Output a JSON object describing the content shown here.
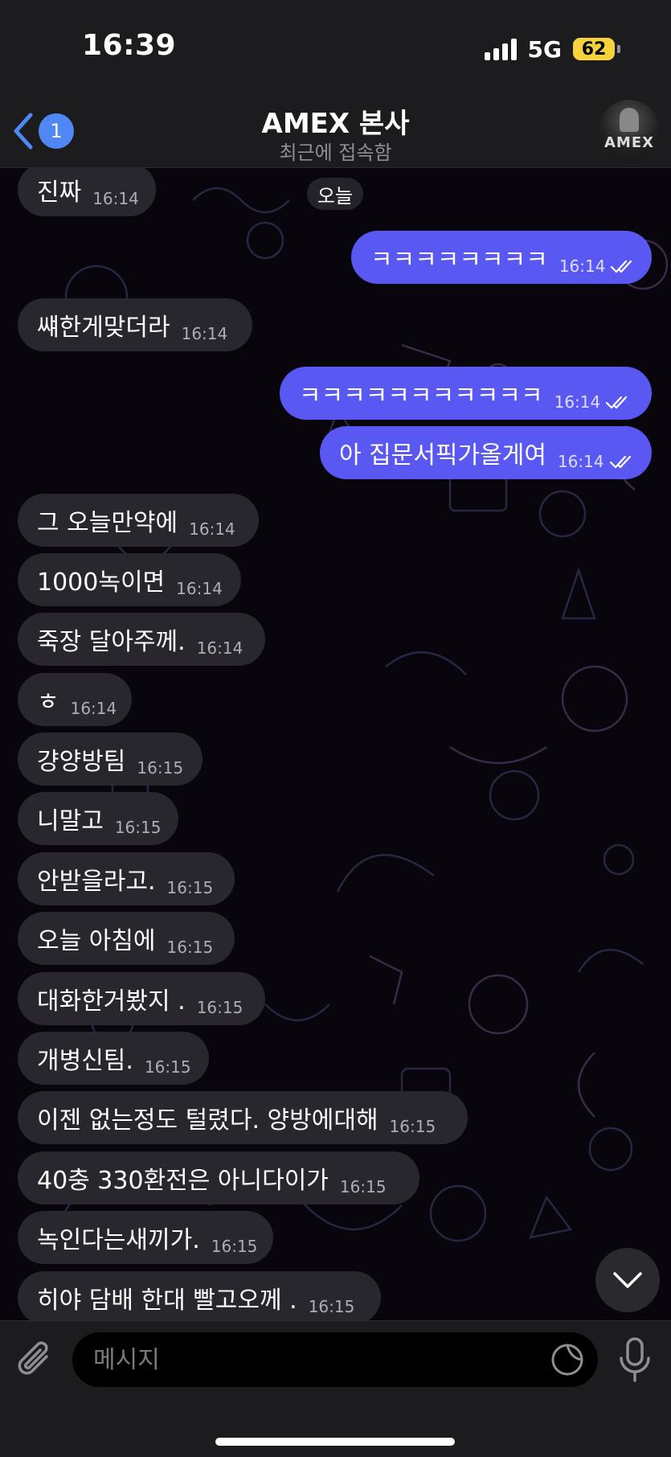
{
  "status_bar": {
    "time": "16:39",
    "network": "5G",
    "battery": "62"
  },
  "header": {
    "back_badge": "1",
    "title": "AMEX 본사",
    "subtitle": "최근에 접속함",
    "avatar_text": "AMEX"
  },
  "chat": {
    "date_label": "오늘",
    "messages": [
      {
        "direction": "in",
        "text": "진짜",
        "time": "16:14"
      },
      {
        "direction": "out",
        "text": "ㅋㅋㅋㅋㅋㅋㅋㅋ",
        "time": "16:14",
        "read": true
      },
      {
        "direction": "in",
        "text": "썌한게맞더라",
        "time": "16:14"
      },
      {
        "direction": "out",
        "text": "ㅋㅋㅋㅋㅋㅋㅋㅋㅋㅋㅋ",
        "time": "16:14",
        "read": true
      },
      {
        "direction": "out",
        "text": "아 집문서픽가올게여",
        "time": "16:14",
        "read": true
      },
      {
        "direction": "in",
        "text": "그 오늘만약에",
        "time": "16:14"
      },
      {
        "direction": "in",
        "text": "1000녹이면",
        "time": "16:14"
      },
      {
        "direction": "in",
        "text": "죽장 달아주께.",
        "time": "16:14"
      },
      {
        "direction": "in",
        "text": "ㅎ",
        "time": "16:14"
      },
      {
        "direction": "in",
        "text": "걍양방팀",
        "time": "16:15"
      },
      {
        "direction": "in",
        "text": "니말고",
        "time": "16:15"
      },
      {
        "direction": "in",
        "text": "안받을라고.",
        "time": "16:15"
      },
      {
        "direction": "in",
        "text": "오늘 아침에",
        "time": "16:15"
      },
      {
        "direction": "in",
        "text": "대화한거봤지 .",
        "time": "16:15"
      },
      {
        "direction": "in",
        "text": "개병신팀.",
        "time": "16:15"
      },
      {
        "direction": "in",
        "text": "이젠 없는정도 털렸다. 양방에대해",
        "time": "16:15"
      },
      {
        "direction": "in",
        "text": "40충 330환전은 아니다이가",
        "time": "16:15"
      },
      {
        "direction": "in",
        "text": "녹인다는새끼가.",
        "time": "16:15"
      },
      {
        "direction": "in",
        "text": "히야 담배 한대 빨고오께 .",
        "time": "16:15"
      }
    ]
  },
  "composer": {
    "placeholder": "메시지"
  },
  "colors": {
    "outgoing_bubble": "#5a58f3",
    "incoming_bubble": "#29272e",
    "accent": "#4f87f5",
    "battery": "#f6d33c"
  },
  "icons": {
    "back": "chevron-left-icon",
    "attach": "paperclip-icon",
    "sticker": "sticker-icon",
    "mic": "microphone-icon",
    "scroll": "chevron-down-icon",
    "read": "double-check-icon"
  }
}
